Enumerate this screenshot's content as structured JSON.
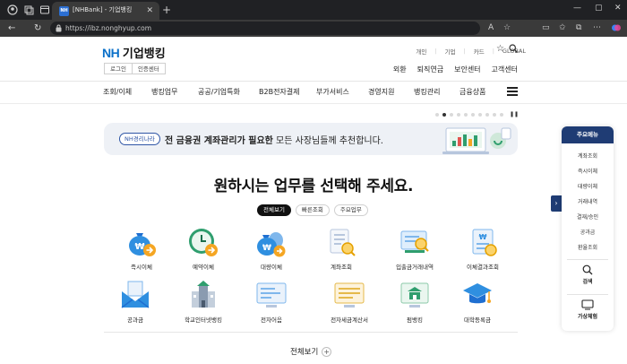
{
  "browser": {
    "tab_title": "[NHBank] - 기업뱅킹",
    "tab_favicon_text": "NH",
    "url": "https://ibz.nonghyup.com"
  },
  "site": {
    "logo_nh": "NH",
    "logo_text": "기업뱅킹",
    "auth": [
      "로그인",
      "인증센터"
    ],
    "top_links": [
      "개인",
      "기업",
      "카드",
      "GLOBAL"
    ],
    "secondary_links": [
      "외환",
      "퇴직연금",
      "보안센터",
      "고객센터"
    ],
    "gnb": [
      "조회/이체",
      "뱅킹업무",
      "공공/기업특화",
      "B2B전자결제",
      "부가서비스",
      "경영지원",
      "뱅킹관리",
      "금융상품"
    ]
  },
  "banner": {
    "badge": "NH경리나라",
    "text_bold": "전 금융권 계좌관리가 필요한",
    "text_rest": " 모든 사장님들께 추천합니다."
  },
  "main": {
    "heading": "원하시는 업무를 선택해 주세요.",
    "filters": [
      "전체보기",
      "빠른조회",
      "주요업무"
    ],
    "tiles": [
      {
        "label": "즉시이체",
        "icon": "money-bag-arrow-icon"
      },
      {
        "label": "예약이체",
        "icon": "clock-arrow-icon"
      },
      {
        "label": "대량이체",
        "icon": "money-bags-icon"
      },
      {
        "label": "계좌조회",
        "icon": "document-search-icon"
      },
      {
        "label": "입출금거래내역",
        "icon": "transaction-search-icon"
      },
      {
        "label": "이체결과조회",
        "icon": "transfer-result-icon"
      },
      {
        "label": "공과금",
        "icon": "envelope-icon"
      },
      {
        "label": "학교인터넷뱅킹",
        "icon": "school-icon"
      },
      {
        "label": "전자어음",
        "icon": "e-bill-icon"
      },
      {
        "label": "전자세금계산서",
        "icon": "tax-invoice-icon"
      },
      {
        "label": "펌뱅킹",
        "icon": "firm-banking-icon"
      },
      {
        "label": "대학등록금",
        "icon": "graduation-cap-icon"
      }
    ],
    "more_label": "전체보기",
    "more_icon": "+"
  },
  "quick_menu": {
    "title": "주요메뉴",
    "items": [
      "계좌조회",
      "즉시이체",
      "대량이체",
      "거래내역",
      "결재/승인",
      "공과금",
      "환율조회"
    ],
    "search_label": "검색",
    "demo_label": "가상체험"
  },
  "colors": {
    "brand_blue": "#0a70c9",
    "navy": "#1f3c74",
    "icon_blue": "#2f8fe0",
    "icon_green": "#2f9e6e",
    "icon_orange": "#f5a623"
  }
}
